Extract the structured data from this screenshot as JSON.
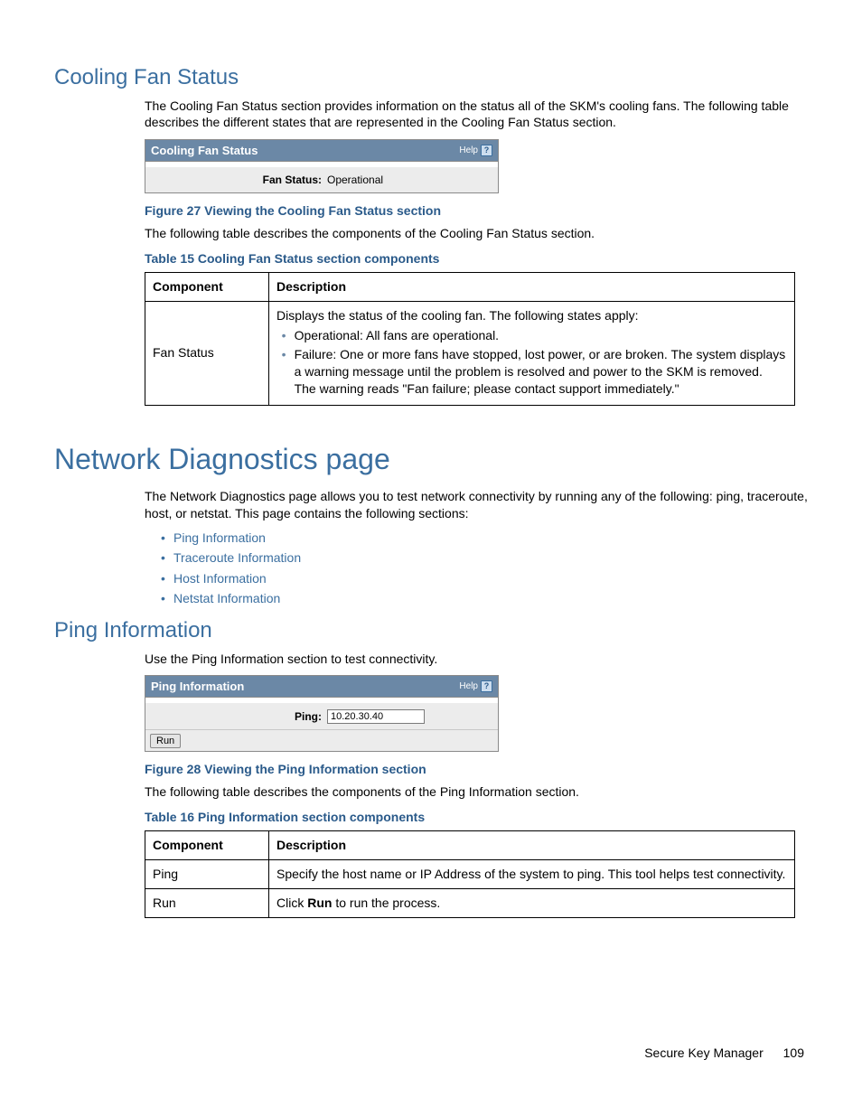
{
  "section1": {
    "heading": "Cooling Fan Status",
    "intro": "The Cooling Fan Status section provides information on the status all of the SKM's cooling fans. The following table describes the different states that are represented in the Cooling Fan Status section.",
    "widget": {
      "title": "Cooling Fan Status",
      "help_label": "Help",
      "row_label": "Fan Status:",
      "row_value": "Operational"
    },
    "figure_caption": "Figure 27 Viewing the Cooling Fan Status section",
    "after_figure": "The following table describes the components of the Cooling Fan Status section.",
    "table_caption": "Table 15 Cooling Fan Status section components",
    "table": {
      "header": {
        "c1": "Component",
        "c2": "Description"
      },
      "row": {
        "component": "Fan Status",
        "desc_intro": "Displays the status of the cooling fan. The following states apply:",
        "states": {
          "op": "Operational: All fans are operational.",
          "fail": "Failure: One or more fans have stopped, lost power, or are broken. The system displays a warning message until the problem is resolved and power to the SKM is removed. The warning reads \"Fan failure; please contact support immediately.\""
        }
      }
    }
  },
  "section2": {
    "heading": "Network Diagnostics page",
    "intro": "The Network Diagnostics page allows you to test network connectivity by running any of the following: ping, traceroute, host, or netstat. This page contains the following sections:",
    "links": {
      "a": "Ping Information",
      "b": "Traceroute Information",
      "c": "Host Information",
      "d": "Netstat Information"
    }
  },
  "section3": {
    "heading": "Ping Information",
    "intro": "Use the Ping Information section to test connectivity.",
    "widget": {
      "title": "Ping Information",
      "help_label": "Help",
      "row_label": "Ping:",
      "input_value": "10.20.30.40",
      "run_label": "Run"
    },
    "figure_caption": "Figure 28 Viewing the Ping Information section",
    "after_figure": "The following table describes the components of the Ping Information section.",
    "table_caption": "Table 16 Ping Information section components",
    "table": {
      "header": {
        "c1": "Component",
        "c2": "Description"
      },
      "rows": {
        "ping": {
          "component": "Ping",
          "desc": "Specify the host name or IP Address of the system to ping. This tool helps test connectivity."
        },
        "run": {
          "component": "Run",
          "desc_pre": "Click ",
          "desc_bold": "Run",
          "desc_post": " to run the process."
        }
      }
    }
  },
  "footer": {
    "product": "Secure Key Manager",
    "page": "109"
  }
}
